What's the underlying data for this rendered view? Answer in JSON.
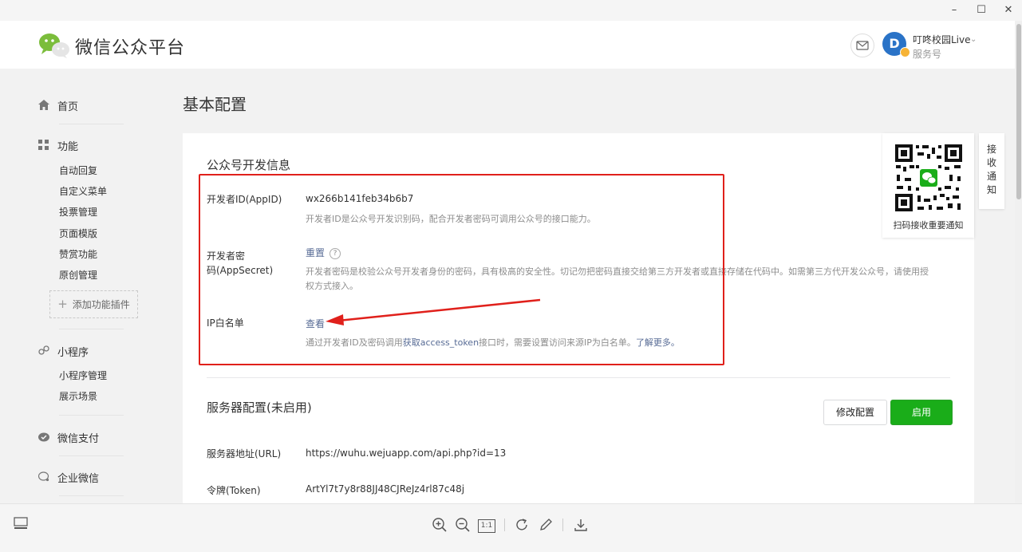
{
  "window": {
    "minimize": "–",
    "maximize": "☐",
    "close": "✕"
  },
  "header": {
    "logo_text": "微信公众平台",
    "account_name": "叮咚校园Live",
    "account_type": "服务号",
    "avatar_letter": "D"
  },
  "sidebar": {
    "home": "首页",
    "function": "功能",
    "function_items": [
      "自动回复",
      "自定义菜单",
      "投票管理",
      "页面模版",
      "赞赏功能",
      "原创管理"
    ],
    "add_plugin": "添加功能插件",
    "miniprogram": "小程序",
    "miniprogram_items": [
      "小程序管理",
      "展示场景"
    ],
    "pay": "微信支付",
    "work": "企业微信"
  },
  "main": {
    "page_title": "基本配置",
    "dev_info": {
      "title": "公众号开发信息",
      "appid_label": "开发者ID(AppID)",
      "appid_value": "wx266b141feb34b6b7",
      "appid_desc": "开发者ID是公众号开发识别码，配合开发者密码可调用公众号的接口能力。",
      "secret_label_1": "开发者密",
      "secret_label_2": "码(AppSecret)",
      "secret_action": "重置",
      "secret_desc_1": "开发者密码是校验公众号开发者身份的密码，具有极高的安全性。切记勿把密码直接交给第三方开发者或直接存储在代码中。如需第三方代开发公众号，请使用授",
      "secret_desc_2": "权方式接入。",
      "ip_label": "IP白名单",
      "ip_action": "查看",
      "ip_desc_prefix": "通过开发者ID及密码调用",
      "ip_desc_link": "获取access_token",
      "ip_desc_suffix": "接口时，需要设置访问来源IP为白名单。",
      "ip_learn_more": "了解更多。"
    },
    "server": {
      "title": "服务器配置(未启用)",
      "modify_button": "修改配置",
      "enable_button": "启用",
      "url_label": "服务器地址(URL)",
      "url_value": "https://wuhu.wejuapp.com/api.php?id=13",
      "token_label": "令牌(Token)",
      "token_value": "ArtYl7t7y8r88JJ48CJReJz4rl87c48j"
    }
  },
  "qr": {
    "caption": "扫码接收重要通知",
    "tab_text": "接收通知"
  },
  "toolbar": {
    "actual_size": "1:1"
  },
  "colors": {
    "annotation_red": "#e0201b",
    "primary_green": "#1aad19",
    "link_blue": "#576b95"
  }
}
